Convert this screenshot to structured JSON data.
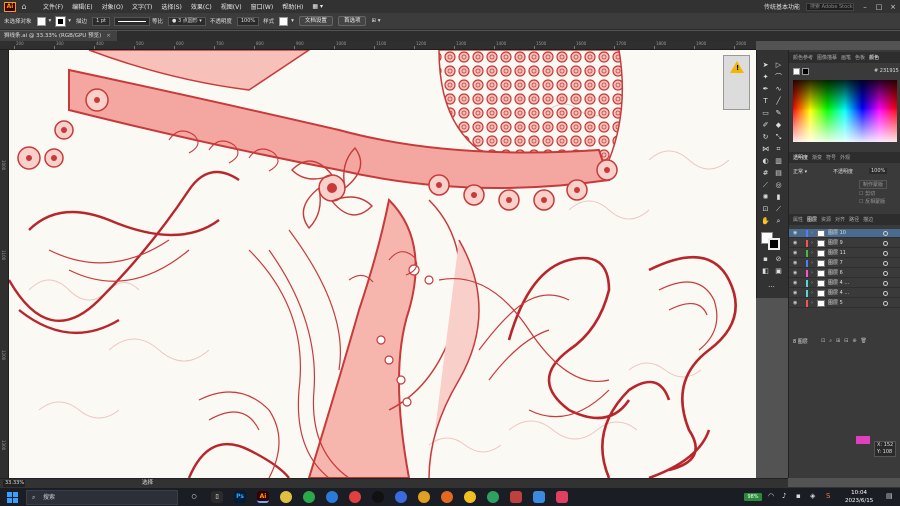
{
  "menubar": {
    "logo": "Ai",
    "items": [
      "文件(F)",
      "编辑(E)",
      "对象(O)",
      "文字(T)",
      "选择(S)",
      "效果(C)",
      "视图(V)",
      "窗口(W)",
      "帮助(H)"
    ],
    "workspace": "传统基本功能",
    "search_placeholder": "搜索 Adobe Stock"
  },
  "controlbar": {
    "no_selection": "未选择对象",
    "stroke_label": "描边",
    "stroke_value": "1 pt",
    "stroke_style": "等比",
    "brush": "3 点圆形",
    "opacity_label": "不透明度",
    "opacity_value": "100%",
    "style_label": "样式",
    "doc_setup": "文档设置",
    "preferences": "首选项"
  },
  "tab": {
    "title": "狮线条.ai @ 33.33% (RGB/GPU 预览)",
    "close": "×"
  },
  "ruler_numbers": [
    "200",
    "300",
    "400",
    "500",
    "600",
    "700",
    "800",
    "900",
    "1000",
    "1100",
    "1200",
    "1300",
    "1400",
    "1500",
    "1600",
    "1700",
    "1800",
    "1900",
    "2000"
  ],
  "color_panel": {
    "tabs": [
      "颜色参考",
      "图像描摹",
      "画笔",
      "色板",
      "颜色"
    ],
    "hex": "231915"
  },
  "transparency_panel": {
    "tabs": [
      "透明度",
      "渐变",
      "符号",
      "外观"
    ],
    "mode": "正常",
    "opacity_label": "不透明度",
    "opacity_value": "100%",
    "make_mask": "制作蒙版",
    "clip": "剪切",
    "invert": "反相蒙版"
  },
  "layers_panel": {
    "tabs": [
      "属性",
      "图层",
      "资源",
      "对齐",
      "路径",
      "描边"
    ],
    "layers": [
      {
        "name": "图层 10",
        "color": "#4f7fff",
        "selected": true
      },
      {
        "name": "图层 9",
        "color": "#ff4f4f",
        "selected": false
      },
      {
        "name": "图层 11",
        "color": "#3fbf3f",
        "selected": false
      },
      {
        "name": "图层 7",
        "color": "#4f7fff",
        "selected": false
      },
      {
        "name": "图层 6",
        "color": "#ff4fd9",
        "selected": false
      },
      {
        "name": "图层 4 ...",
        "color": "#4fd9d9",
        "selected": false
      },
      {
        "name": "图层 4 ...",
        "color": "#4fd9d9",
        "selected": false
      },
      {
        "name": "图层 5",
        "color": "#ff4f4f",
        "selected": false
      }
    ],
    "footer": "8 图层"
  },
  "status": {
    "zoom": "33.33%",
    "selection": "选择"
  },
  "coord_readout": {
    "x": "X: 152",
    "y": "Y: 108"
  },
  "taskbar": {
    "search_placeholder": "搜索",
    "battery": "98%",
    "time": "10:04",
    "date": "2023/6/15"
  },
  "colors": {
    "artwork_red": "#c83a3a",
    "artwork_fill": "#f4a7a0",
    "canvas_bg": "#fbf9f4",
    "ui_dark": "#323232"
  }
}
